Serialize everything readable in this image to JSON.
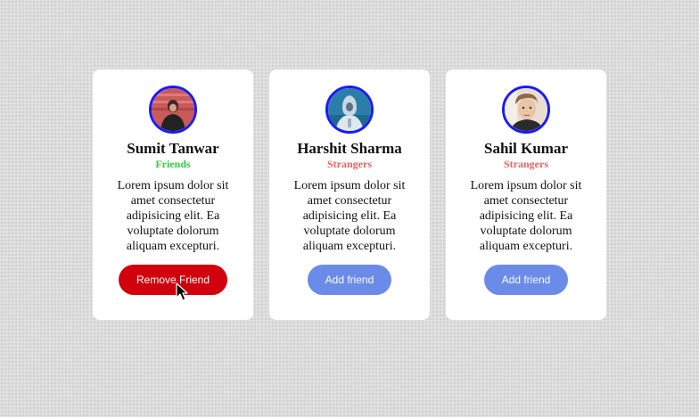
{
  "colors": {
    "friends_status": "#2ecc40",
    "strangers_status": "#e06666",
    "remove_button": "#d0000c",
    "add_button": "#6b8be8",
    "avatar_border": "#1a1aff"
  },
  "cards": [
    {
      "name": "Sumit Tanwar",
      "status": "Friends",
      "description": "Lorem ipsum dolor sit amet consectetur adipisicing elit. Ea voluptate dolorum aliquam excepturi.",
      "button_label": "Remove Friend"
    },
    {
      "name": "Harshit Sharma",
      "status": "Strangers",
      "description": "Lorem ipsum dolor sit amet consectetur adipisicing elit. Ea voluptate dolorum aliquam excepturi.",
      "button_label": "Add friend"
    },
    {
      "name": "Sahil Kumar",
      "status": "Strangers",
      "description": "Lorem ipsum dolor sit amet consectetur adipisicing elit. Ea voluptate dolorum aliquam excepturi.",
      "button_label": "Add friend"
    }
  ]
}
